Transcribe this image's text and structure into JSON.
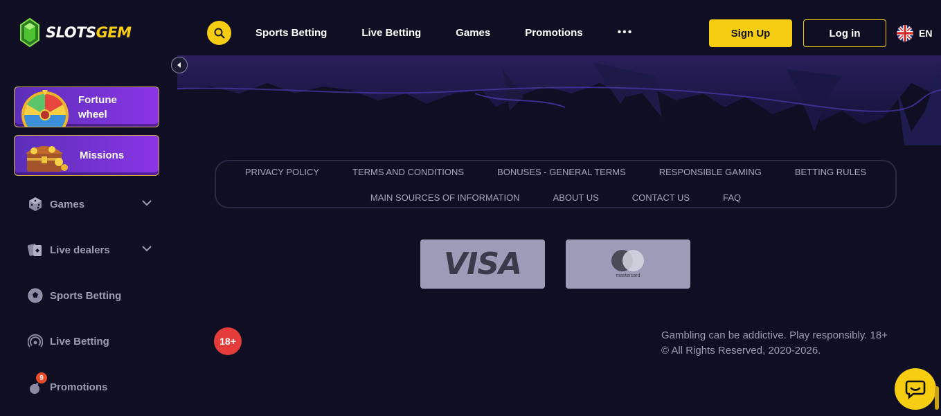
{
  "brand": {
    "name_white": "SLOTS",
    "name_yellow": "GEM"
  },
  "header": {
    "nav": [
      "Sports Betting",
      "Live Betting",
      "Games",
      "Promotions"
    ],
    "more_label": "•••",
    "signup_label": "Sign Up",
    "login_label": "Log in",
    "language": "EN"
  },
  "sidebar": {
    "fortune_label_1": "Fortune",
    "fortune_label_2": "wheel",
    "missions_label": "Missions",
    "items": [
      {
        "label": "Games",
        "icon": "dice-icon",
        "has_chevron": true
      },
      {
        "label": "Live dealers",
        "icon": "cards-icon",
        "has_chevron": true
      },
      {
        "label": "Sports Betting",
        "icon": "soccer-ball-icon",
        "has_chevron": false
      },
      {
        "label": "Live Betting",
        "icon": "broadcast-icon",
        "has_chevron": false
      },
      {
        "label": "Promotions",
        "icon": "bomb-icon",
        "has_chevron": false,
        "badge": "9"
      }
    ]
  },
  "footer": {
    "links_row1": [
      "PRIVACY POLICY",
      "TERMS AND CONDITIONS",
      "BONUSES - GENERAL TERMS",
      "RESPONSIBLE GAMING",
      "BETTING RULES"
    ],
    "links_row2": [
      "MAIN SOURCES OF INFORMATION",
      "ABOUT US",
      "CONTACT US",
      "FAQ"
    ],
    "payments": {
      "visa": "VISA",
      "mastercard": "mastercard"
    },
    "age": "18+",
    "disclaimer_1": "Gambling can be addictive. Play responsibly. 18+",
    "disclaimer_2": "© All Rights Reserved, 2020-2026."
  },
  "colors": {
    "background": "#0f0e22",
    "accent": "#f7cd12",
    "purple_card": "#7a33d8",
    "muted_text": "#9c9cb4",
    "age_badge": "#e43b3b"
  }
}
